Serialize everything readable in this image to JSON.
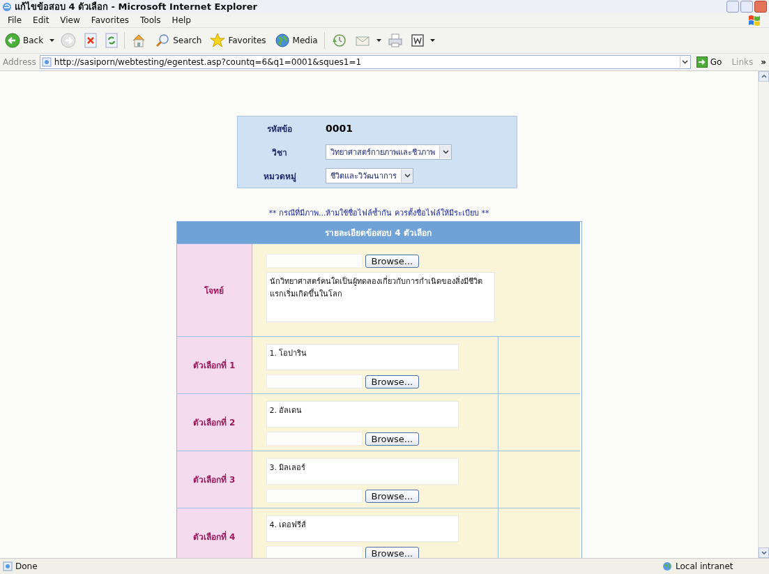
{
  "window": {
    "title": "แก้ไขข้อสอบ 4 ตัวเลือก - Microsoft Internet Explorer"
  },
  "menu": [
    "File",
    "Edit",
    "View",
    "Favorites",
    "Tools",
    "Help"
  ],
  "toolbar": [
    {
      "kind": "back",
      "label": "Back"
    },
    {
      "kind": "forward"
    },
    {
      "kind": "stop"
    },
    {
      "kind": "refresh"
    },
    {
      "kind": "home"
    },
    {
      "kind": "search",
      "label": "Search"
    },
    {
      "kind": "favorites",
      "label": "Favorites"
    },
    {
      "kind": "media",
      "label": "Media"
    },
    {
      "kind": "history"
    },
    {
      "kind": "mail"
    },
    {
      "kind": "print"
    },
    {
      "kind": "word"
    }
  ],
  "address": {
    "label": "Address",
    "url": "http://sasiporn/webtesting/egentest.asp?countq=6&q1=0001&sques1=1",
    "go": "Go",
    "links": "Links",
    "more": "»"
  },
  "info": {
    "rows": [
      {
        "kind": "text",
        "label": "รหัสข้อ",
        "value": "0001"
      },
      {
        "kind": "select",
        "label": "วิชา",
        "value": "วิทยาศาสตร์กายภาพและชีวภาพ"
      },
      {
        "kind": "select",
        "label": "หมวดหมู่",
        "value": "ชีวิตและวิวัฒนาการ"
      }
    ]
  },
  "note": "** กรณีที่มีภาพ...ห้ามใช้ชื่อไฟล์ซ้ำกัน ควรตั้งชื่อไฟล์ให้มีระเบียบ **",
  "form": {
    "heading": "รายละเอียดข้อสอบ 4 ตัวเลือก",
    "question": {
      "label": "โจทย์",
      "browse": "Browse...",
      "text": "นักวิทยาศาสตร์คนใดเป็นผู้ทดลองเกี่ยวกับการกำเนิดของสิ่งมีชีวิตแรกเริ่มเกิดขึ้นในโลก"
    },
    "choices": [
      {
        "label": "ตัวเลือกที่ 1",
        "text": "1. โอปาริน",
        "browse": "Browse..."
      },
      {
        "label": "ตัวเลือกที่ 2",
        "text": "2. อัลเดน",
        "browse": "Browse..."
      },
      {
        "label": "ตัวเลือกที่ 3",
        "text": "3. มิลเลอร์",
        "browse": "Browse..."
      },
      {
        "label": "ตัวเลือกที่ 4",
        "text": "4. เดอฟรีส์",
        "browse": "Browse..."
      }
    ]
  },
  "status_bar": {
    "text": "Done",
    "zone": "Local intranet"
  }
}
